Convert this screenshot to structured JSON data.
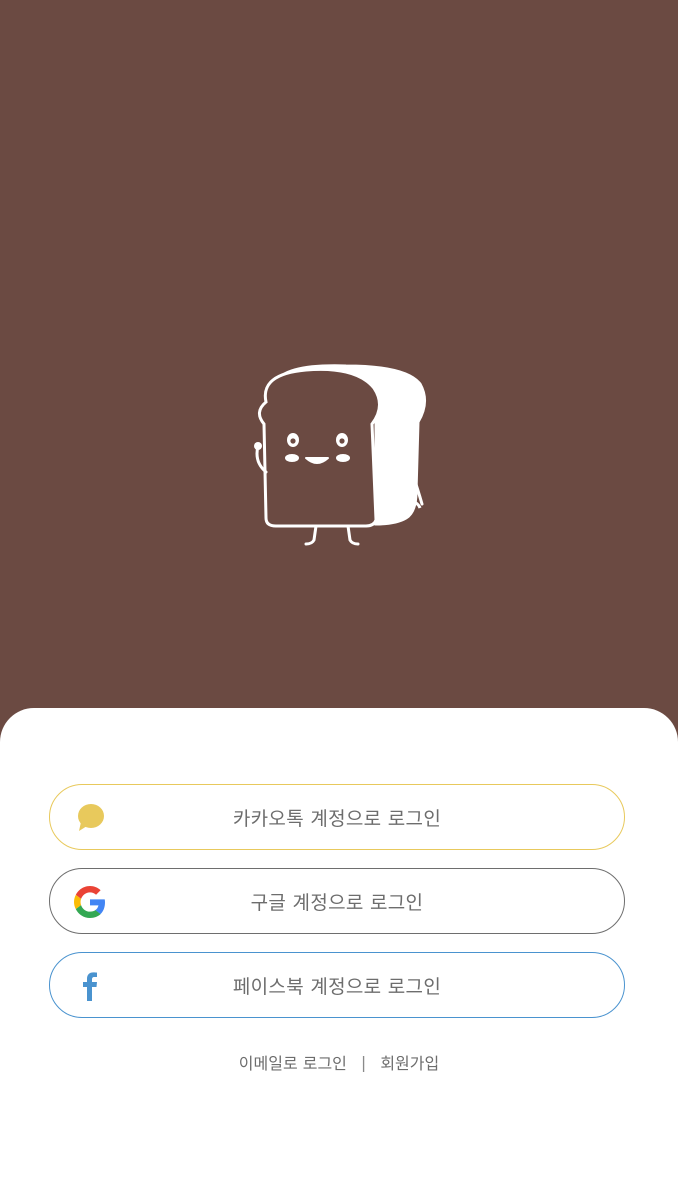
{
  "colors": {
    "background": "#6b4a42",
    "sheet": "#ffffff",
    "kakao_border": "#e8c95c",
    "google_border": "#6e6e6e",
    "facebook_border": "#4a93cf",
    "text": "#6d6d6d"
  },
  "hero": {
    "mascot_icon": "bread-mascot-icon"
  },
  "login": {
    "kakao": {
      "label": "카카오톡 계정으로 로그인",
      "icon": "kakao-talk-icon"
    },
    "google": {
      "label": "구글 계정으로 로그인",
      "icon": "google-icon"
    },
    "facebook": {
      "label": "페이스북 계정으로 로그인",
      "icon": "facebook-icon"
    }
  },
  "links": {
    "email_login": "이메일로 로그인",
    "separator": "|",
    "signup": "회원가입"
  }
}
